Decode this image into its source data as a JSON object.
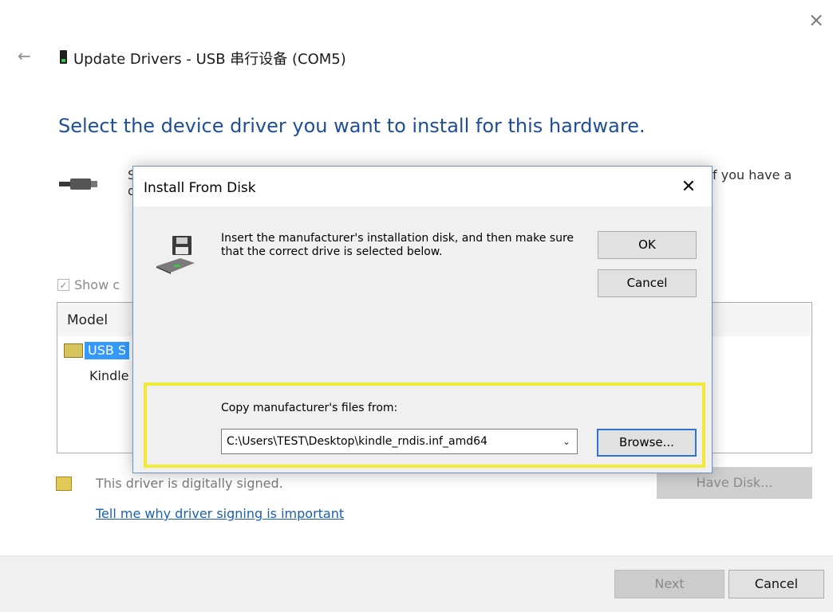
{
  "window": {
    "title": "Update Drivers - USB 串行设备 (COM5)",
    "close_icon": "×",
    "back_icon": "←"
  },
  "page": {
    "heading": "Select the device driver you want to install for this hardware.",
    "description_fragment_left": "S",
    "description_fragment_left_2": "d",
    "description_fragment_right": "f you have a",
    "show_compatible_label": "Show c",
    "model_header": "Model",
    "models": [
      "USB S",
      "Kindle"
    ],
    "signed_text": "This driver is digitally signed.",
    "signing_link": "Tell me why driver signing is important",
    "have_disk_label": "Have Disk..."
  },
  "footer": {
    "next_label": "Next",
    "cancel_label": "Cancel"
  },
  "dialog": {
    "title": "Install From Disk",
    "close_icon": "✕",
    "instructions": "Insert the manufacturer's installation disk, and then make sure that the correct drive is selected below.",
    "ok_label": "OK",
    "cancel_label": "Cancel",
    "copy_label": "Copy manufacturer's files from:",
    "path_value": "C:\\Users\\TEST\\Desktop\\kindle_rndis.inf_amd64",
    "chevron_icon": "⌄",
    "browse_label": "Browse...",
    "highlight_color": "#f2ea35"
  }
}
